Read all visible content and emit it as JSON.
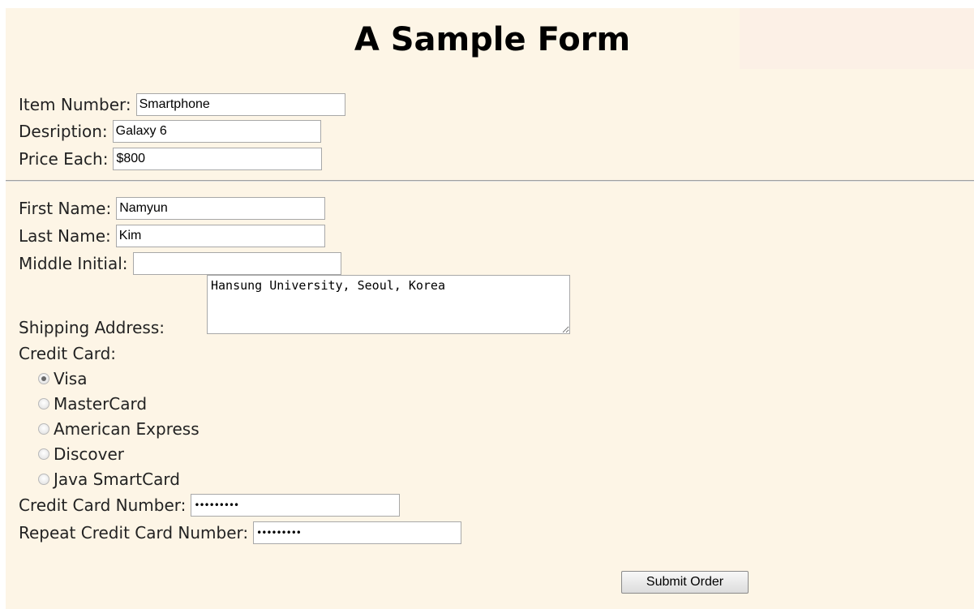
{
  "title": "A Sample Form",
  "item": {
    "number_label": "Item Number",
    "number_value": "Smartphone",
    "description_label": "Desription",
    "description_value": "Galaxy 6",
    "price_label": "Price Each",
    "price_value": "$800"
  },
  "customer": {
    "first_name_label": "First Name",
    "first_name_value": "Namyun",
    "last_name_label": "Last Name",
    "last_name_value": "Kim",
    "middle_initial_label": "Middle Initial",
    "middle_initial_value": "",
    "address_label": "Shipping Address:",
    "address_value": "Hansung University, Seoul, Korea"
  },
  "credit_card": {
    "label": "Credit Card:",
    "options": [
      "Visa",
      "MasterCard",
      "American Express",
      "Discover",
      "Java SmartCard"
    ],
    "selected": "Visa",
    "number_label": "Credit Card Number",
    "number_value": "•••••••••",
    "repeat_label": "Repeat Credit Card Number",
    "repeat_value": "•••••••••"
  },
  "submit_label": "Submit Order",
  "colors": {
    "page_background": "#fdf5e6",
    "title_band": "#fcf0e6"
  }
}
